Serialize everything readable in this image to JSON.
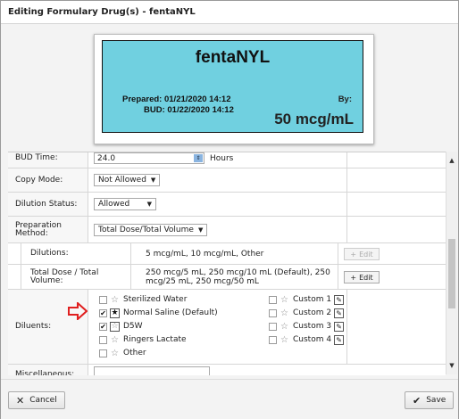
{
  "dialog": {
    "title": "Editing Formulary Drug(s) - fentaNYL"
  },
  "label_preview": {
    "drug_name_prefix": "fenta",
    "drug_name_caps": "NYL",
    "prepared": "Prepared: 01/21/2020 14:12",
    "bud": "BUD: 01/22/2020 14:12",
    "by": "By:",
    "concentration": "50 mcg/mL",
    "color": "#70d0e0"
  },
  "form": {
    "bud_time": {
      "label": "BUD Time:",
      "value": "24.0",
      "unit": "Hours"
    },
    "copy_mode": {
      "label": "Copy Mode:",
      "value": "Not Allowed"
    },
    "dilution_status": {
      "label": "Dilution Status:",
      "value": "Allowed"
    },
    "preparation_method": {
      "label": "Preparation Method:",
      "value": "Total Dose/Total Volume"
    },
    "dilutions": {
      "label": "Dilutions:",
      "value": "5 mcg/mL, 10 mcg/mL, Other",
      "edit": "Edit"
    },
    "total_dose": {
      "label": "Total Dose / Total Volume:",
      "value": "250 mcg/5 mL, 250 mcg/10 mL (Default), 250 mcg/25 mL, 250 mcg/50 mL",
      "edit": "Edit"
    },
    "diluents": {
      "label": "Diluents:",
      "items": [
        {
          "name": "Sterilized Water",
          "checked": false
        },
        {
          "name": "Normal Saline (Default)",
          "checked": true
        },
        {
          "name": "D5W",
          "checked": true
        },
        {
          "name": "Ringers Lactate",
          "checked": false
        },
        {
          "name": "Other",
          "checked": false
        }
      ],
      "custom": [
        {
          "name": "Custom 1",
          "checked": false
        },
        {
          "name": "Custom 2",
          "checked": false
        },
        {
          "name": "Custom 3",
          "checked": false
        },
        {
          "name": "Custom 4",
          "checked": false
        }
      ]
    },
    "miscellaneous": {
      "label": "Miscellaneous:"
    }
  },
  "footer": {
    "cancel": "Cancel",
    "save": "Save"
  },
  "colors": {
    "arrow": "#e02020"
  }
}
